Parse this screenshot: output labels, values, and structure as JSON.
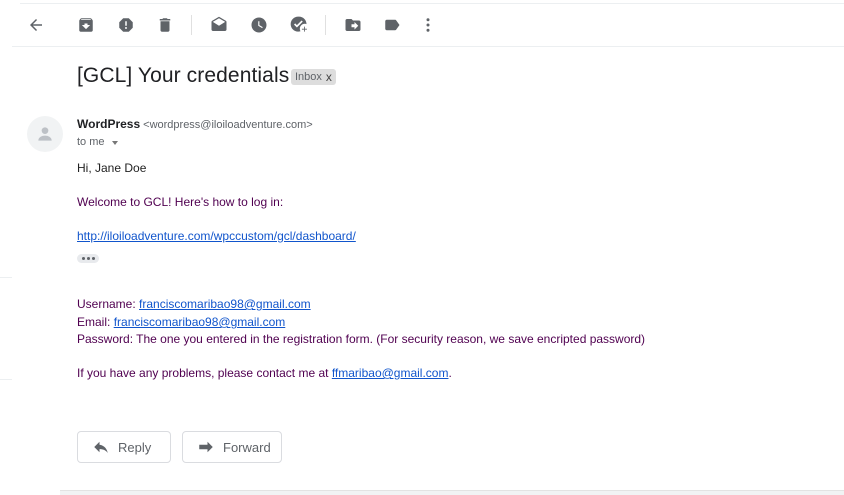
{
  "toolbar": {
    "icons": [
      "back-arrow-icon",
      "archive-icon",
      "report-spam-icon",
      "delete-icon",
      "mark-unread-icon",
      "snooze-icon",
      "add-task-icon",
      "move-to-icon",
      "label-icon",
      "more-options-icon"
    ]
  },
  "email": {
    "subject": "[GCL] Your credentials.",
    "label": "Inbox",
    "label_close": "x",
    "sender_name": "WordPress",
    "sender_address": "<wordpress@iloiloadventure.com>",
    "recipient": "to me",
    "body": {
      "greeting": "Hi, Jane Doe",
      "welcome": "Welcome to GCL! Here's how to log in:",
      "login_url": "http://iloiloadventure.com/wpccustom/gcl/dashboard/",
      "username_label": "Username: ",
      "username_value": "franciscomaribao98@gmail.com",
      "email_label": "Email: ",
      "email_value": "franciscomaribao98@gmail.com",
      "password_line": "Password: The one you entered in the registration form. (For security reason, we save encripted password)",
      "contact_prefix": "If you have any problems, please contact me at ",
      "contact_email": "ffmaribao@gmail.com",
      "contact_suffix": "."
    }
  },
  "actions": {
    "reply_label": "Reply",
    "forward_label": "Forward"
  }
}
